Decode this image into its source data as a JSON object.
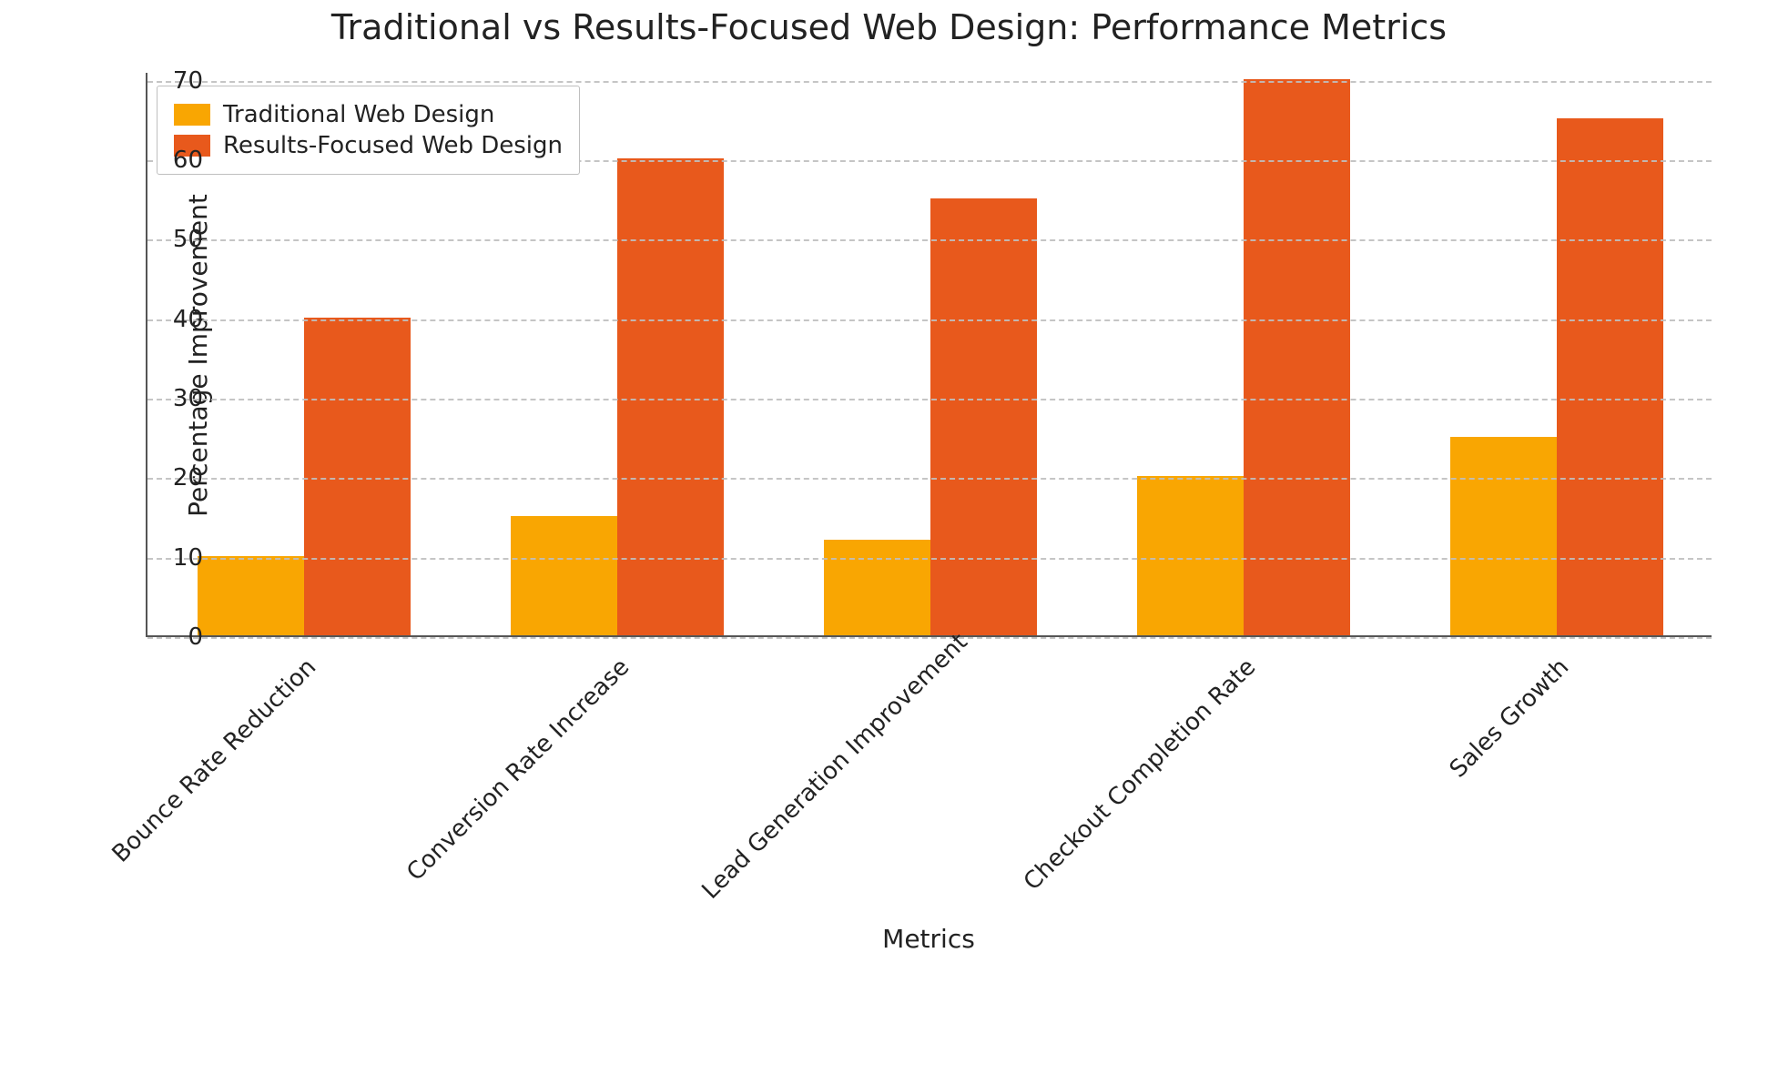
{
  "chart_data": {
    "type": "bar",
    "title": "Traditional vs Results-Focused Web Design: Performance Metrics",
    "xlabel": "Metrics",
    "ylabel": "Percentage Improvement",
    "categories": [
      "Bounce Rate Reduction",
      "Conversion Rate Increase",
      "Lead Generation Improvement",
      "Checkout Completion Rate",
      "Sales Growth"
    ],
    "series": [
      {
        "name": "Traditional Web Design",
        "color": "#f9a602",
        "values": [
          10,
          15,
          12,
          20,
          25
        ]
      },
      {
        "name": "Results-Focused Web Design",
        "color": "#e8591c",
        "values": [
          40,
          60,
          55,
          70,
          65
        ]
      }
    ],
    "ylim": [
      0,
      71
    ],
    "yticks": [
      0,
      10,
      20,
      30,
      40,
      50,
      60,
      70
    ],
    "grid": true,
    "legend_position": "upper-left"
  }
}
